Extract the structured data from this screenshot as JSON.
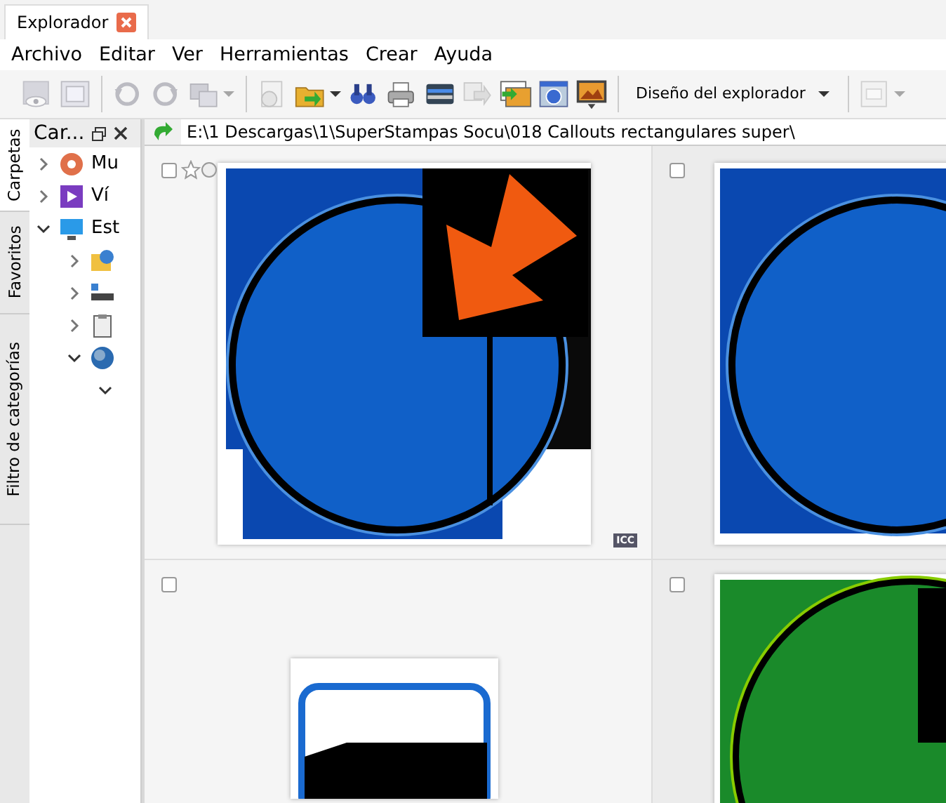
{
  "window": {
    "tab_title": "Explorador"
  },
  "menu": [
    "Archivo",
    "Editar",
    "Ver",
    "Herramientas",
    "Crear",
    "Ayuda"
  ],
  "toolbar": [
    {
      "kind": "button",
      "disabled": true
    },
    {
      "kind": "button",
      "disabled": true
    },
    {
      "kind": "separator"
    },
    {
      "kind": "button",
      "disabled": true
    },
    {
      "kind": "button",
      "disabled": true
    },
    {
      "kind": "split",
      "disabled": true
    },
    {
      "kind": "separator"
    },
    {
      "kind": "button",
      "disabled": true
    },
    {
      "kind": "split",
      "disabled": false
    },
    {
      "kind": "button",
      "disabled": false
    },
    {
      "kind": "button",
      "disabled": false
    },
    {
      "kind": "button",
      "disabled": false
    },
    {
      "kind": "button",
      "disabled": true
    },
    {
      "kind": "button",
      "disabled": false
    },
    {
      "kind": "button",
      "disabled": false
    },
    {
      "kind": "button",
      "disabled": false
    },
    {
      "kind": "separator"
    },
    {
      "kind": "menu",
      "label": "Diseño del explorador"
    },
    {
      "kind": "separator"
    },
    {
      "kind": "split",
      "disabled": true
    }
  ],
  "side_tabs": [
    {
      "label": "Carpetas",
      "selected": true
    },
    {
      "label": "Favoritos",
      "selected": false
    },
    {
      "label": "Filtro de categorías",
      "selected": false
    }
  ],
  "folder_panel": {
    "title": "Car...",
    "tree": [
      {
        "label": "Mu",
        "expanded": false
      },
      {
        "label": "Ví",
        "expanded": false
      },
      {
        "label": "Est",
        "expanded": true,
        "children": [
          {
            "expanded": false
          },
          {
            "expanded": false
          },
          {
            "expanded": false
          },
          {
            "expanded": true,
            "children": [
              {
                "expanded": true
              }
            ]
          }
        ]
      }
    ]
  },
  "address": {
    "path": "E:\\1 Descargas\\1\\SuperStampas Socu\\018 Callouts rectangulares super\\"
  },
  "thumbnails": [
    {
      "kind": "callout",
      "checked": false,
      "hovered": true,
      "badge": "ICC"
    },
    {
      "kind": "circle",
      "checked": false,
      "hovered": false
    },
    {
      "kind": "frame",
      "checked": false,
      "hovered": false
    },
    {
      "kind": "green",
      "checked": false,
      "hovered": false
    }
  ]
}
